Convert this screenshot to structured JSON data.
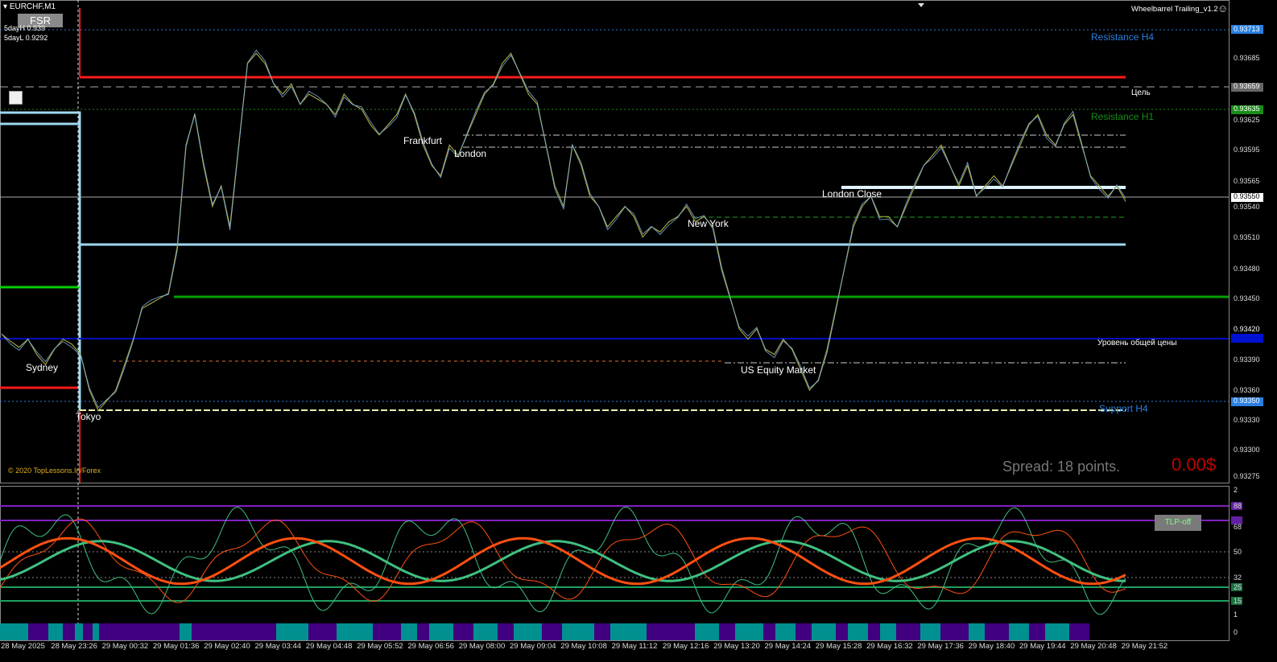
{
  "header": {
    "symbol": "EURCHF,M1",
    "day_high": "5dayH 0.939",
    "day_low": "5dayL 0.9292",
    "fsr_button": "FSR",
    "ea_name": "Wheelbarrel Trailing_v1.2",
    "copyright": "© 2020 TopLessons.In/Forex"
  },
  "levels": {
    "resistance_h4": "Resistance H4",
    "target": "Цель",
    "resistance_h1": "Resistance H1",
    "common_price": "Уровень общей цены",
    "support_h4": "Support H4"
  },
  "sessions": {
    "sydney": "Sydney",
    "tokyo": "Tokyo",
    "frankfurt": "Frankfurt",
    "london": "London",
    "new_york": "New York",
    "london_close": "London Close",
    "us_equity": "US Equity Market"
  },
  "info": {
    "spread": "Spread: 18 points.",
    "profit": "0.00$",
    "tlp_button": "TLP-off"
  },
  "price_axis": [
    "0.93713",
    "0.93685",
    "0.93659",
    "0.93635",
    "0.93625",
    "0.93595",
    "0.93565",
    "0.93550",
    "0.93540",
    "0.93510",
    "0.93480",
    "0.93450",
    "0.93420",
    "0.93390",
    "0.93360",
    "0.93350",
    "0.93330",
    "0.93300",
    "0.93275"
  ],
  "indicator_axis": [
    "2",
    "88",
    "68",
    "50",
    "32",
    "25",
    "15",
    "1",
    "0"
  ],
  "time_axis": [
    "28 May 2025",
    "28 May 23:26",
    "29 May 00:32",
    "29 May 01:36",
    "29 May 02:40",
    "29 May 03:44",
    "29 May 04:48",
    "29 May 05:52",
    "29 May 06:56",
    "29 May 08:00",
    "29 May 09:04",
    "29 May 10:08",
    "29 May 11:12",
    "29 May 12:16",
    "29 May 13:20",
    "29 May 14:24",
    "29 May 15:28",
    "29 May 16:32",
    "29 May 17:36",
    "29 May 18:40",
    "29 May 19:44",
    "29 May 20:48",
    "29 May 21:52"
  ],
  "colors": {
    "background": "#000000",
    "candles_up": "#7fb0e0",
    "candles_down": "#a0a040",
    "red_line": "#ff1a1a",
    "light_blue_line": "#9fd8f0",
    "green_line": "#00c000",
    "blue_line": "#0010c0",
    "resistance_h4": "#2a80e0",
    "resistance_h1": "#1a8c1a",
    "indicator_orange": "#ff5010",
    "indicator_green": "#40c080",
    "indicator_purple": "#8020c0",
    "teal_block": "#009090",
    "purple_block": "#400080"
  },
  "chart_data": {
    "type": "line",
    "series": [
      {
        "values": [
          0.93415,
          0.93408,
          0.93402,
          0.9341,
          0.93395,
          0.93385,
          0.934,
          0.9341,
          0.93405,
          0.93395,
          0.9336,
          0.9334,
          0.9335,
          0.9336,
          0.93385,
          0.9341,
          0.9344,
          0.93445,
          0.9345,
          0.93455,
          0.935,
          0.936,
          0.9363,
          0.9358,
          0.9354,
          0.9356,
          0.9352,
          0.936,
          0.9368,
          0.9369,
          0.9368,
          0.9366,
          0.9365,
          0.9366,
          0.9364,
          0.9365,
          0.93645,
          0.9364,
          0.9363,
          0.9365,
          0.9364,
          0.93635,
          0.9362,
          0.9361,
          0.9362,
          0.9363,
          0.9365,
          0.9363,
          0.936,
          0.9358,
          0.9357,
          0.936,
          0.9359,
          0.9361,
          0.9363,
          0.9365,
          0.9366,
          0.9368,
          0.9369,
          0.9367,
          0.9365,
          0.9364,
          0.936,
          0.9356,
          0.9354,
          0.936,
          0.9358,
          0.9355,
          0.9354,
          0.9352,
          0.9353,
          0.9354,
          0.9353,
          0.9351,
          0.9352,
          0.93515,
          0.93525,
          0.9353,
          0.9354,
          0.93525,
          0.9353,
          0.9352,
          0.9348,
          0.9345,
          0.9342,
          0.9341,
          0.9342,
          0.934,
          0.93395,
          0.9341,
          0.934,
          0.9338,
          0.9336,
          0.9337,
          0.934,
          0.9344,
          0.9348,
          0.9352,
          0.9354,
          0.9355,
          0.9353,
          0.9353,
          0.9352,
          0.9354,
          0.9356,
          0.9358,
          0.9359,
          0.936,
          0.9358,
          0.9356,
          0.9358,
          0.9355,
          0.9356,
          0.9357,
          0.9356,
          0.9358,
          0.936,
          0.9362,
          0.9363,
          0.9361,
          0.936,
          0.9362,
          0.9363,
          0.936,
          0.9357,
          0.9356,
          0.9355,
          0.9356,
          0.93545
        ]
      }
    ]
  }
}
